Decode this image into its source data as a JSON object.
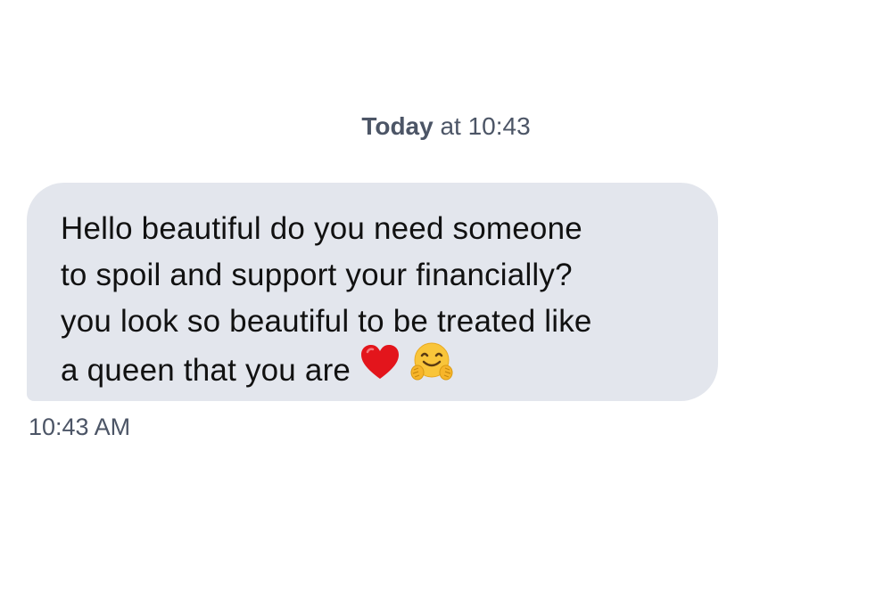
{
  "conversation": {
    "date_header": {
      "day": "Today",
      "rest": " at 10:43"
    },
    "message": {
      "lines": [
        "Hello beautiful do you need someone",
        "to spoil and support your financially?",
        "you look so beautiful to be treated like",
        "a queen that you are"
      ],
      "emojis": [
        "red-heart-icon",
        "hugging-face-icon"
      ],
      "timestamp": "10:43 AM"
    }
  },
  "colors": {
    "bubble_background": "#e3e6ed",
    "meta_text": "#4c5566",
    "message_text": "#111111"
  }
}
